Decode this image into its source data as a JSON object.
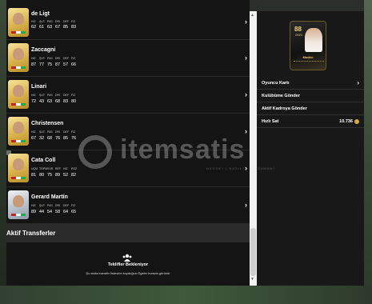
{
  "watermark": {
    "brand": "itemsatis",
    "tagline": "NERDE? | NASIL? | NE ZAMAN?"
  },
  "players": [
    {
      "name": "de Ligt",
      "headers": [
        "HIZ",
        "ŞUT",
        "PAS",
        "DRI",
        "DEF",
        "FIZ"
      ],
      "values": [
        "62",
        "61",
        "63",
        "67",
        "85",
        "83"
      ],
      "card": "gold"
    },
    {
      "name": "Zaccagni",
      "headers": [
        "HIZ",
        "ŞUT",
        "PAS",
        "DRI",
        "DEF",
        "FIZ"
      ],
      "values": [
        "87",
        "77",
        "75",
        "87",
        "57",
        "66"
      ],
      "card": "gold"
    },
    {
      "name": "Linari",
      "headers": [
        "HIZ",
        "ŞUT",
        "PAS",
        "DRI",
        "DEF",
        "FIZ"
      ],
      "values": [
        "72",
        "43",
        "63",
        "68",
        "83",
        "80"
      ],
      "card": "gold"
    },
    {
      "name": "Christensen",
      "headers": [
        "HIZ",
        "ŞUT",
        "PAS",
        "DRI",
        "DEF",
        "FIZ"
      ],
      "values": [
        "67",
        "32",
        "68",
        "76",
        "85",
        "76"
      ],
      "card": "gold"
    },
    {
      "name": "Cata Coll",
      "headers": [
        "UÇM",
        "TOPM",
        "VUR",
        "REF",
        "HIZ",
        "POZ"
      ],
      "values": [
        "81",
        "80",
        "75",
        "89",
        "52",
        "82"
      ],
      "card": "gold"
    },
    {
      "name": "Gerard Martín",
      "headers": [
        "HIZ",
        "ŞUT",
        "PAS",
        "DRI",
        "DEF",
        "FIZ"
      ],
      "values": [
        "89",
        "44",
        "54",
        "58",
        "64",
        "65"
      ],
      "card": "silver"
    }
  ],
  "section": {
    "title": "Aktif Transferler"
  },
  "empty": {
    "title": "Teklifler Bekleniyor",
    "subtitle": "Şu anda transfer listesine koyduğun Ögeler burada görünür"
  },
  "detail_card": {
    "rating": "88",
    "position": "OOS",
    "name": "Modric"
  },
  "menu": {
    "player_card": "Oyuncu Kartı",
    "send_club": "Kulübüme Gönder",
    "send_active_squad": "Aktif Kadroya Gönder",
    "quick_sell": "Hızlı Sat",
    "quick_sell_price": "10.736"
  },
  "colors": {
    "coin": "#d6a73a",
    "gold_card": "#d9b24c",
    "panel": "#141414"
  }
}
